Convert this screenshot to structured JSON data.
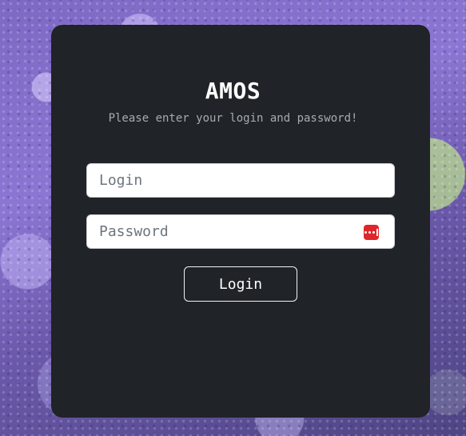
{
  "app": {
    "title": "AMOS",
    "subtitle": "Please enter your login and password!"
  },
  "form": {
    "login_placeholder": "Login",
    "login_value": "",
    "password_placeholder": "Password",
    "password_value": "",
    "password_manager_icon": "password-manager-icon",
    "submit_label": "Login"
  },
  "colors": {
    "card_background": "#202327",
    "title_text": "#ffffff",
    "subtitle_text": "#a8abb1",
    "input_background": "#ffffff",
    "button_border": "#f3f4f6",
    "password_icon": "#e0262a"
  }
}
